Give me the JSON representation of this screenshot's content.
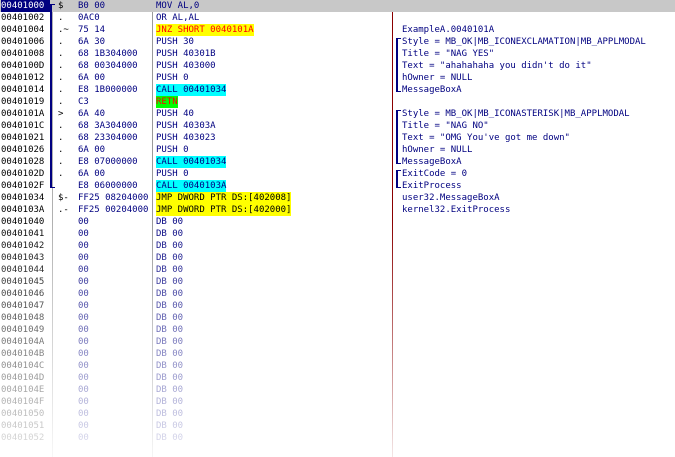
{
  "rows": [
    {
      "addr": "00401000",
      "mark": "$",
      "hex": "B0 00",
      "asm": "MOV AL,0",
      "asm_style": "",
      "comment": ""
    },
    {
      "addr": "00401002",
      "mark": ".",
      "hex": "0AC0",
      "asm": "OR AL,AL",
      "asm_style": "",
      "comment": ""
    },
    {
      "addr": "00401004",
      "mark": ".~",
      "hex": "75 14",
      "asm": "JNZ SHORT 0040101A",
      "asm_style": "hl-yellow",
      "comment": "ExampleA.0040101A"
    },
    {
      "addr": "00401006",
      "mark": ".",
      "hex": "6A 30",
      "asm": "PUSH 30",
      "asm_style": "",
      "comment": "Style = MB_OK|MB_ICONEXCLAMATION|MB_APPLMODAL"
    },
    {
      "addr": "00401008",
      "mark": ".",
      "hex": "68 1B304000",
      "asm": "PUSH 40301B",
      "asm_style": "",
      "comment": "Title = \"NAG YES\""
    },
    {
      "addr": "0040100D",
      "mark": ".",
      "hex": "68 00304000",
      "asm": "PUSH 403000",
      "asm_style": "",
      "comment": "Text = \"ahahahaha you didn't do it\""
    },
    {
      "addr": "00401012",
      "mark": ".",
      "hex": "6A 00",
      "asm": "PUSH 0",
      "asm_style": "",
      "comment": "hOwner = NULL"
    },
    {
      "addr": "00401014",
      "mark": ".",
      "hex": "E8 1B000000",
      "asm": "CALL 00401034",
      "asm_style": "hl-cyan",
      "comment": "MessageBoxA"
    },
    {
      "addr": "00401019",
      "mark": ".",
      "hex": "C3",
      "asm": "RETN",
      "asm_style": "hl-green",
      "comment": ""
    },
    {
      "addr": "0040101A",
      "mark": ">",
      "hex": "6A 40",
      "asm": "PUSH 40",
      "asm_style": "",
      "comment": "Style = MB_OK|MB_ICONASTERISK|MB_APPLMODAL"
    },
    {
      "addr": "0040101C",
      "mark": ".",
      "hex": "68 3A304000",
      "asm": "PUSH 40303A",
      "asm_style": "",
      "comment": "Title = \"NAG NO\""
    },
    {
      "addr": "00401021",
      "mark": ".",
      "hex": "68 23304000",
      "asm": "PUSH 403023",
      "asm_style": "",
      "comment": "Text = \"OMG You've got me down\""
    },
    {
      "addr": "00401026",
      "mark": ".",
      "hex": "6A 00",
      "asm": "PUSH 0",
      "asm_style": "",
      "comment": "hOwner = NULL"
    },
    {
      "addr": "00401028",
      "mark": ".",
      "hex": "E8 07000000",
      "asm": "CALL 00401034",
      "asm_style": "hl-cyan",
      "comment": "MessageBoxA"
    },
    {
      "addr": "0040102D",
      "mark": ".",
      "hex": "6A 00",
      "asm": "PUSH 0",
      "asm_style": "",
      "comment": "ExitCode = 0"
    },
    {
      "addr": "0040102F",
      "mark": "",
      "hex": "E8 06000000",
      "asm": "CALL 0040103A",
      "asm_style": "hl-cyan",
      "comment": "ExitProcess"
    },
    {
      "addr": "00401034",
      "mark": "$-",
      "hex": "FF25 08204000",
      "asm": "JMP DWORD PTR DS:[402008]",
      "asm_style": "hl-yellow-b",
      "comment": "user32.MessageBoxA"
    },
    {
      "addr": "0040103A",
      "mark": ".-",
      "hex": "FF25 00204000",
      "asm": "JMP DWORD PTR DS:[402000]",
      "asm_style": "hl-yellow-b",
      "comment": "kernel32.ExitProcess"
    },
    {
      "addr": "00401040",
      "mark": "",
      "hex": "00",
      "asm": "DB 00",
      "asm_style": "",
      "comment": ""
    },
    {
      "addr": "00401041",
      "mark": "",
      "hex": "00",
      "asm": "DB 00",
      "asm_style": "",
      "comment": ""
    },
    {
      "addr": "00401042",
      "mark": "",
      "hex": "00",
      "asm": "DB 00",
      "asm_style": "",
      "comment": ""
    },
    {
      "addr": "00401043",
      "mark": "",
      "hex": "00",
      "asm": "DB 00",
      "asm_style": "",
      "comment": ""
    },
    {
      "addr": "00401044",
      "mark": "",
      "hex": "00",
      "asm": "DB 00",
      "asm_style": "",
      "comment": ""
    },
    {
      "addr": "00401045",
      "mark": "",
      "hex": "00",
      "asm": "DB 00",
      "asm_style": "",
      "comment": ""
    },
    {
      "addr": "00401046",
      "mark": "",
      "hex": "00",
      "asm": "DB 00",
      "asm_style": "",
      "comment": ""
    },
    {
      "addr": "00401047",
      "mark": "",
      "hex": "00",
      "asm": "DB 00",
      "asm_style": "",
      "comment": ""
    },
    {
      "addr": "00401048",
      "mark": "",
      "hex": "00",
      "asm": "DB 00",
      "asm_style": "",
      "comment": ""
    },
    {
      "addr": "00401049",
      "mark": "",
      "hex": "00",
      "asm": "DB 00",
      "asm_style": "",
      "comment": ""
    },
    {
      "addr": "0040104A",
      "mark": "",
      "hex": "00",
      "asm": "DB 00",
      "asm_style": "",
      "comment": ""
    },
    {
      "addr": "0040104B",
      "mark": "",
      "hex": "00",
      "asm": "DB 00",
      "asm_style": "",
      "comment": ""
    },
    {
      "addr": "0040104C",
      "mark": "",
      "hex": "00",
      "asm": "DB 00",
      "asm_style": "",
      "comment": ""
    },
    {
      "addr": "0040104D",
      "mark": "",
      "hex": "00",
      "asm": "DB 00",
      "asm_style": "",
      "comment": ""
    },
    {
      "addr": "0040104E",
      "mark": "",
      "hex": "00",
      "asm": "DB 00",
      "asm_style": "",
      "comment": ""
    },
    {
      "addr": "0040104F",
      "mark": "",
      "hex": "00",
      "asm": "DB 00",
      "asm_style": "",
      "comment": ""
    },
    {
      "addr": "00401050",
      "mark": "",
      "hex": "00",
      "asm": "DB 00",
      "asm_style": "",
      "comment": ""
    },
    {
      "addr": "00401051",
      "mark": "",
      "hex": "00",
      "asm": "DB 00",
      "asm_style": "",
      "comment": ""
    },
    {
      "addr": "00401052",
      "mark": "",
      "hex": "00",
      "asm": "DB 00",
      "asm_style": "",
      "comment": ""
    }
  ],
  "selected_index": 0,
  "colors": {
    "selection": "#000080",
    "jump_highlight": "#ffff00",
    "call_highlight": "#00ffff",
    "return_highlight": "#00ff00",
    "column_divider": "#8b0000"
  }
}
